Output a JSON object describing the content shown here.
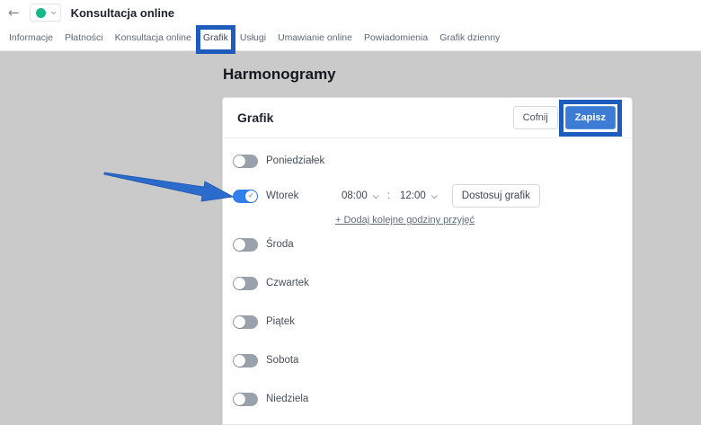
{
  "header": {
    "title": "Konsultacja online",
    "back_icon": "←"
  },
  "tabs": [
    {
      "label": "Informacje"
    },
    {
      "label": "Płatności"
    },
    {
      "label": "Konsultacja online"
    },
    {
      "label": "Grafik",
      "highlighted": true
    },
    {
      "label": "Usługi"
    },
    {
      "label": "Umawianie online"
    },
    {
      "label": "Powiadomienia"
    },
    {
      "label": "Grafik dzienny"
    }
  ],
  "page": {
    "heading": "Harmonogramy"
  },
  "card": {
    "title": "Grafik",
    "cancel_label": "Cofnij",
    "save_label": "Zapisz"
  },
  "schedule": {
    "days": [
      {
        "label": "Poniedziałek",
        "enabled": false
      },
      {
        "label": "Wtorek",
        "enabled": true,
        "start_time": "08:00",
        "time_separator": ":",
        "end_time": "12:00",
        "adjust_label": "Dostosuj grafik",
        "add_link": "+ Dodaj kolejne godziny przyjęć",
        "check_icon": "✓"
      },
      {
        "label": "Środa",
        "enabled": false
      },
      {
        "label": "Czwartek",
        "enabled": false
      },
      {
        "label": "Piątek",
        "enabled": false
      },
      {
        "label": "Sobota",
        "enabled": false
      },
      {
        "label": "Niedziela",
        "enabled": false
      }
    ]
  },
  "colors": {
    "annotation_blue": "#1d5bbd",
    "save_button_blue": "#3d7cd4",
    "toggle_on_blue": "#2f80ed",
    "status_dot_green": "#17b98a",
    "background_gray": "#cacaca"
  }
}
